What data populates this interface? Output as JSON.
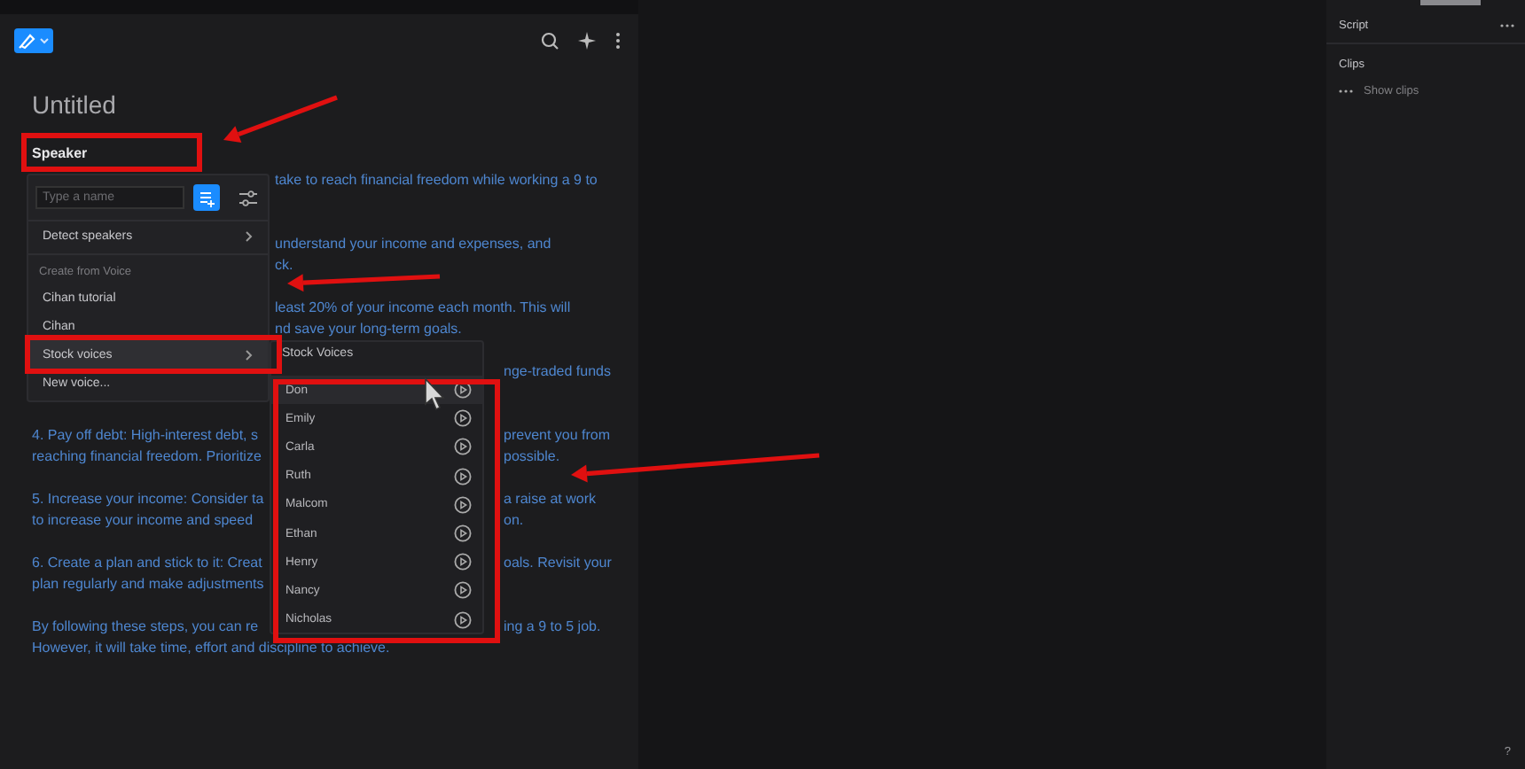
{
  "document": {
    "title": "Untitled",
    "speaker_label": "Speaker",
    "paragraphs": [
      {
        "lines": [
          {
            "kind": "menu",
            "right": "take to reach financial freedom while working a 9 to"
          }
        ]
      },
      {
        "lines": [
          {
            "kind": "menu",
            "right": "understand your income and expenses, and"
          },
          {
            "kind": "menu",
            "right": "ck."
          }
        ]
      },
      {
        "lines": [
          {
            "kind": "menu",
            "right": "least 20% of your income each month. This will"
          },
          {
            "kind": "menu",
            "right": "nd save your long-term goals."
          }
        ]
      },
      {
        "lines": [
          {
            "kind": "submenu",
            "right": "nge-traded funds"
          }
        ]
      },
      {
        "lines": [
          {
            "kind": "submenu",
            "left": "4. Pay off debt: High-interest debt, s",
            "right": "prevent you from"
          },
          {
            "kind": "submenu",
            "left": "reaching financial freedom. Prioritize",
            "right": "possible."
          }
        ]
      },
      {
        "lines": [
          {
            "kind": "submenu",
            "left": "5. Increase your income: Consider ta",
            "right": "a raise at work"
          },
          {
            "kind": "submenu",
            "left": "to increase your income and speed",
            "right": "on."
          }
        ]
      },
      {
        "lines": [
          {
            "kind": "submenu",
            "left": "6. Create a plan and stick to it: Creat",
            "right": "oals. Revisit your"
          },
          {
            "kind": "submenu",
            "left": "plan regularly and make adjustments"
          }
        ]
      },
      {
        "lines": [
          {
            "kind": "submenu",
            "left": "By following these steps, you can re",
            "right": "ing a 9 to 5 job."
          },
          {
            "kind": "full",
            "left": "However, it will take time, effort and discipline to achieve."
          }
        ]
      }
    ]
  },
  "speaker_menu": {
    "search": {
      "placeholder": "Type a name"
    },
    "items": [
      {
        "kind": "action",
        "label": "Detect speakers",
        "submenu": true,
        "selected": false
      },
      {
        "kind": "header",
        "label": "Create from Voice"
      },
      {
        "kind": "action",
        "label": "Cihan tutorial",
        "submenu": false,
        "selected": false
      },
      {
        "kind": "action",
        "label": "Cihan",
        "submenu": false,
        "selected": false
      },
      {
        "kind": "action",
        "label": "Stock voices",
        "submenu": true,
        "selected": true
      },
      {
        "kind": "action",
        "label": "New voice...",
        "submenu": false,
        "selected": false
      }
    ]
  },
  "stock_voices": {
    "title": "Stock Voices",
    "voices": [
      {
        "name": "Don",
        "selected": true
      },
      {
        "name": "Emily",
        "selected": false
      },
      {
        "name": "Carla",
        "selected": false
      },
      {
        "name": "Ruth",
        "selected": false
      },
      {
        "name": "Malcom",
        "selected": false
      },
      {
        "name": "Ethan",
        "selected": false
      },
      {
        "name": "Henry",
        "selected": false
      },
      {
        "name": "Nancy",
        "selected": false
      },
      {
        "name": "Nicholas",
        "selected": false
      }
    ]
  },
  "sidebar": {
    "script": "Script",
    "clips_title": "Clips",
    "clips_action": "Show clips",
    "help": "?"
  }
}
